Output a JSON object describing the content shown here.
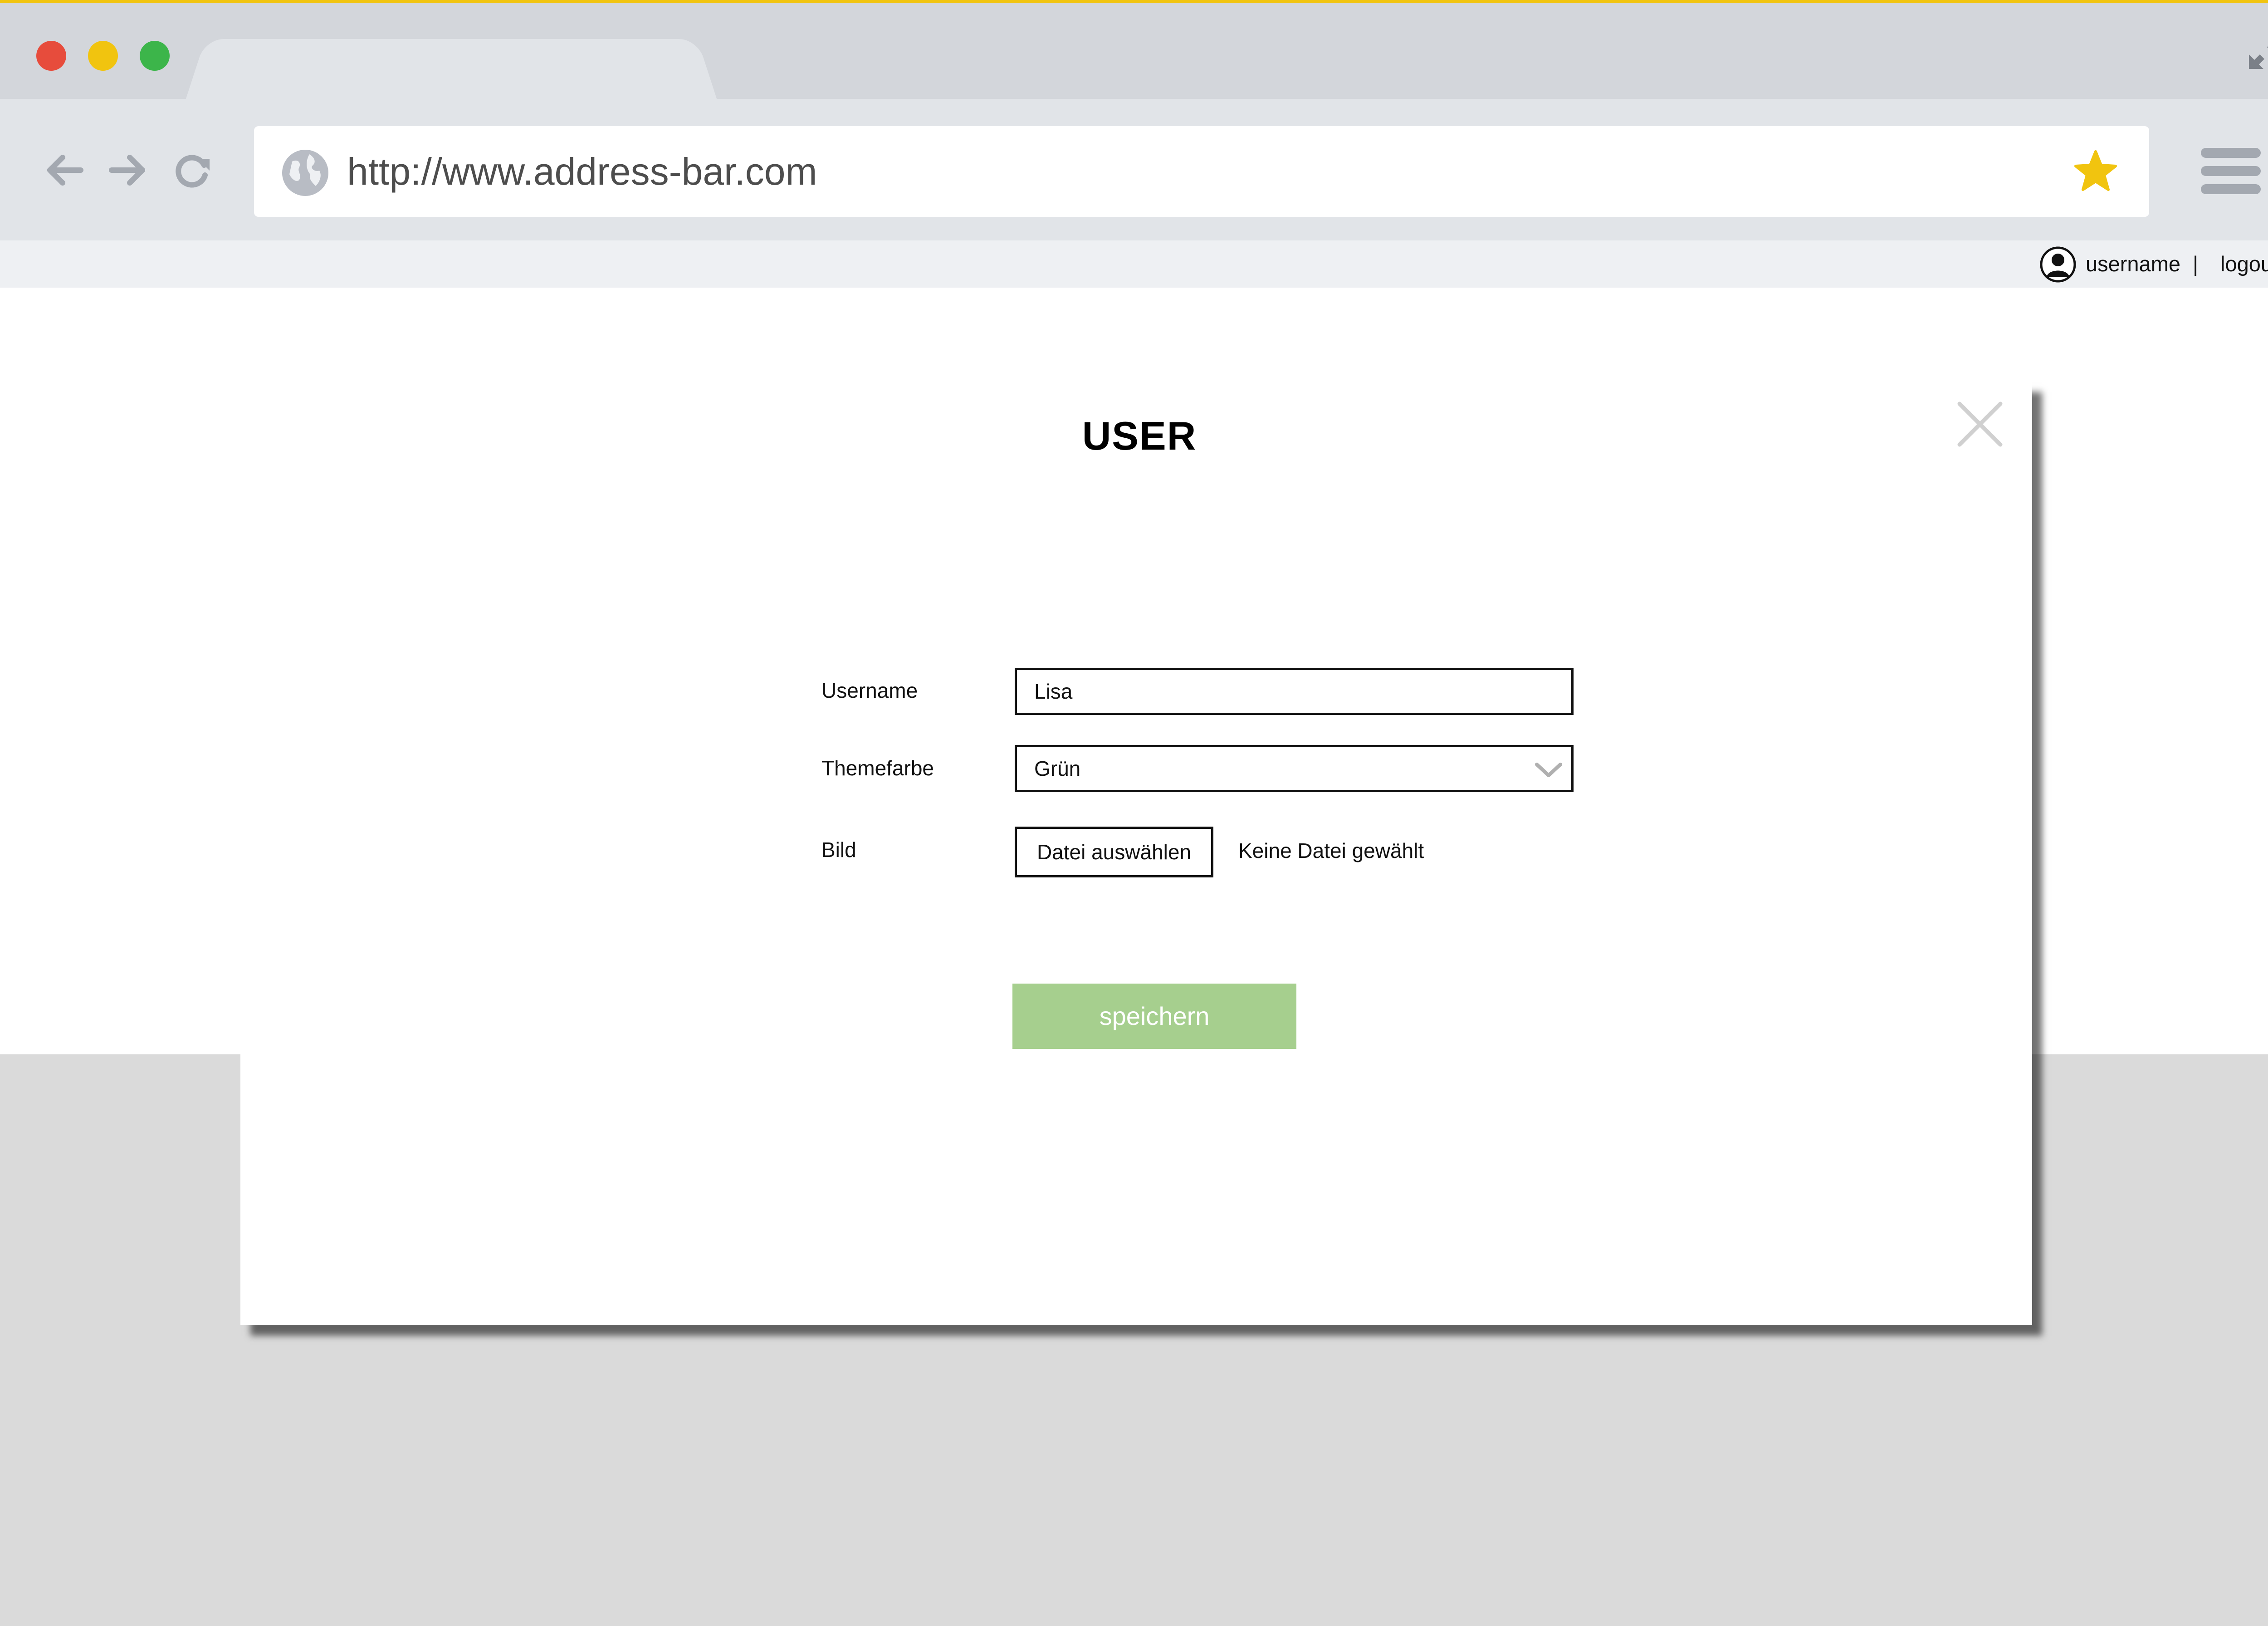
{
  "browser": {
    "url": "http://www.address-bar.com",
    "traffic_lights": [
      "#e74c3c",
      "#f1c40f",
      "#3cb54a"
    ],
    "accent_color": "#f1c40f"
  },
  "userbar": {
    "username": "username",
    "separator": "|",
    "logout": "logout"
  },
  "modal": {
    "title": "USER",
    "fields": {
      "username_label": "Username",
      "username_value": "Lisa",
      "theme_label": "Themefarbe",
      "theme_value": "Grün",
      "image_label": "Bild",
      "file_button": "Datei auswählen",
      "file_status": "Keine Datei gewählt"
    },
    "save_label": "speichern",
    "save_color": "#a6cf8e"
  },
  "icons": [
    "back-arrow-icon",
    "forward-arrow-icon",
    "reload-icon",
    "globe-icon",
    "star-icon",
    "hamburger-menu-icon",
    "fullscreen-icon",
    "user-avatar-icon",
    "close-icon",
    "chevron-down-icon"
  ]
}
